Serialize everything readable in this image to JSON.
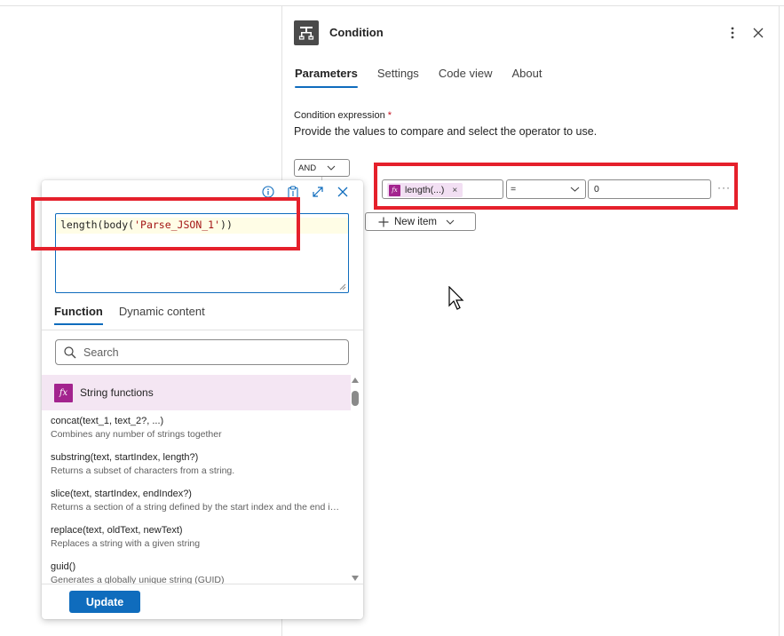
{
  "panel": {
    "title": "Condition",
    "tabs": [
      {
        "label": "Parameters",
        "active": true
      },
      {
        "label": "Settings",
        "active": false
      },
      {
        "label": "Code view",
        "active": false
      },
      {
        "label": "About",
        "active": false
      }
    ],
    "condition_label": "Condition expression",
    "required_marker": "*",
    "condition_desc": "Provide the values to compare and select the operator to use.",
    "group_operator": "AND",
    "row": {
      "left_token": "length(...)",
      "left_token_remove": "×",
      "operator": "=",
      "right_value": "0",
      "more": "···"
    },
    "new_item_label": "New item"
  },
  "popup": {
    "expression_prefix": "length(body(",
    "expression_string": "'Parse_JSON_1'",
    "expression_suffix": "))",
    "tabs": [
      {
        "label": "Function",
        "active": true
      },
      {
        "label": "Dynamic content",
        "active": false
      }
    ],
    "search_placeholder": "Search",
    "group_label": "String functions",
    "functions": [
      {
        "sig": "concat(text_1, text_2?, ...)",
        "desc": "Combines any number of strings together"
      },
      {
        "sig": "substring(text, startIndex, length?)",
        "desc": "Returns a subset of characters from a string."
      },
      {
        "sig": "slice(text, startIndex, endIndex?)",
        "desc": "Returns a section of a string defined by the start index and the end index"
      },
      {
        "sig": "replace(text, oldText, newText)",
        "desc": "Replaces a string with a given string"
      },
      {
        "sig": "guid()",
        "desc": "Generates a globally unique string (GUID)"
      }
    ],
    "update_label": "Update"
  },
  "icons": {
    "condition": "condition-icon",
    "more": "more-vertical-icon",
    "close": "close-icon",
    "info": "info-icon",
    "clipboard": "clipboard-icon",
    "expand": "expand-icon",
    "search": "search-icon",
    "fx": "fx-icon",
    "chevron": "chevron-down-icon",
    "add": "plus-icon"
  },
  "colors": {
    "accent": "#0f6cbd",
    "highlight_box": "#e5202b",
    "fx_badge": "#a3238e",
    "token_bg": "#f2dff3"
  }
}
